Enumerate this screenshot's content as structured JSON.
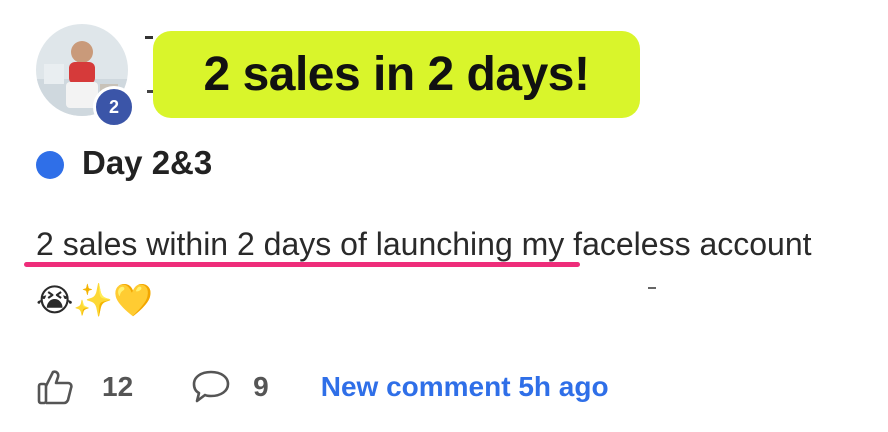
{
  "post": {
    "headline": "2 sales in 2 days!",
    "level_badge": "2",
    "category_color": "#2f6fe8",
    "title": "Day 2&3",
    "body": "2 sales within 2 days of launching my faceless account😭✨💛",
    "likes": "12",
    "comments": "9",
    "new_comment_link": "New comment 5h ago"
  },
  "colors": {
    "highlight": "#d9f52b",
    "underline": "#ee2d7a",
    "link": "#2f6fe8",
    "badge": "#3b55a8"
  },
  "icons": [
    "avatar-photo",
    "thumbs-up-icon",
    "comment-bubble-icon"
  ]
}
